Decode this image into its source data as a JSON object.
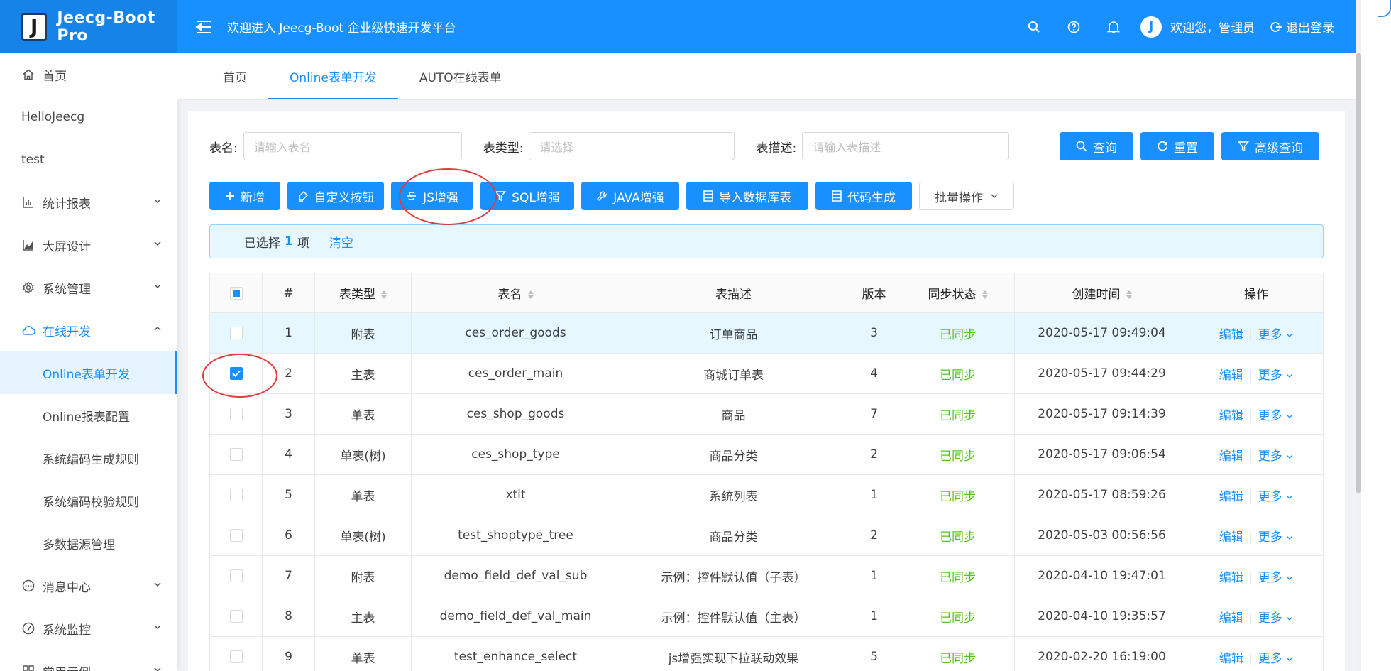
{
  "header": {
    "logo_letter": "J",
    "brand": "Jeecg-Boot Pro",
    "welcome": "欢迎进入 Jeecg-Boot 企业级快速开发平台",
    "avatar_letter": "J",
    "user_greeting": "欢迎您，管理员",
    "logout": "退出登录"
  },
  "sidebar": {
    "items": [
      {
        "label": "首页",
        "icon": "home-icon"
      },
      {
        "label": "HelloJeecg"
      },
      {
        "label": "test"
      },
      {
        "label": "统计报表",
        "icon": "bar-chart-icon"
      },
      {
        "label": "大屏设计",
        "icon": "area-chart-icon"
      },
      {
        "label": "系统管理",
        "icon": "gear-icon"
      },
      {
        "label": "在线开发",
        "icon": "cloud-icon"
      },
      {
        "label": "Online表单开发"
      },
      {
        "label": "Online报表配置"
      },
      {
        "label": "系统编码生成规则"
      },
      {
        "label": "系统编码校验规则"
      },
      {
        "label": "多数据源管理"
      },
      {
        "label": "消息中心",
        "icon": "message-icon"
      },
      {
        "label": "系统监控",
        "icon": "dashboard-icon"
      },
      {
        "label": "常用示例"
      }
    ]
  },
  "tabs": [
    "首页",
    "Online表单开发",
    "AUTO在线表单"
  ],
  "filters": {
    "table_name_label": "表名:",
    "table_name_placeholder": "请输入表名",
    "table_type_label": "表类型:",
    "table_type_placeholder": "请选择",
    "table_desc_label": "表描述:",
    "table_desc_placeholder": "请输入表描述"
  },
  "query_buttons": {
    "search": "查询",
    "reset": "重置",
    "advanced": "高级查询"
  },
  "toolbar": {
    "add": "新增",
    "custom_button": "自定义按钮",
    "js_enhance": "JS增强",
    "sql_enhance": "SQL增强",
    "java_enhance": "JAVA增强",
    "import_db": "导入数据库表",
    "code_gen": "代码生成",
    "batch": "批量操作"
  },
  "alert": {
    "prefix": "已选择",
    "count": "1",
    "suffix": "项",
    "clear": "清空"
  },
  "table": {
    "headers": [
      "#",
      "表类型",
      "表名",
      "表描述",
      "版本",
      "同步状态",
      "创建时间",
      "操作"
    ],
    "edit": "编辑",
    "more": "更多",
    "rows": [
      {
        "no": "1",
        "type": "附表",
        "name": "ces_order_goods",
        "desc": "订单商品",
        "ver": "3",
        "sync": "已同步",
        "time": "2020-05-17 09:49:04"
      },
      {
        "no": "2",
        "type": "主表",
        "name": "ces_order_main",
        "desc": "商城订单表",
        "ver": "4",
        "sync": "已同步",
        "time": "2020-05-17 09:44:29"
      },
      {
        "no": "3",
        "type": "单表",
        "name": "ces_shop_goods",
        "desc": "商品",
        "ver": "7",
        "sync": "已同步",
        "time": "2020-05-17 09:14:39"
      },
      {
        "no": "4",
        "type": "单表(树)",
        "name": "ces_shop_type",
        "desc": "商品分类",
        "ver": "2",
        "sync": "已同步",
        "time": "2020-05-17 09:06:54"
      },
      {
        "no": "5",
        "type": "单表",
        "name": "xtlt",
        "desc": "系统列表",
        "ver": "1",
        "sync": "已同步",
        "time": "2020-05-17 08:59:26"
      },
      {
        "no": "6",
        "type": "单表(树)",
        "name": "test_shoptype_tree",
        "desc": "商品分类",
        "ver": "2",
        "sync": "已同步",
        "time": "2020-05-03 00:56:56"
      },
      {
        "no": "7",
        "type": "附表",
        "name": "demo_field_def_val_sub",
        "desc": "示例：控件默认值（子表）",
        "ver": "1",
        "sync": "已同步",
        "time": "2020-04-10 19:47:01"
      },
      {
        "no": "8",
        "type": "主表",
        "name": "demo_field_def_val_main",
        "desc": "示例：控件默认值（主表）",
        "ver": "1",
        "sync": "已同步",
        "time": "2020-04-10 19:35:57"
      },
      {
        "no": "9",
        "type": "单表",
        "name": "test_enhance_select",
        "desc": "js增强实现下拉联动效果",
        "ver": "5",
        "sync": "已同步",
        "time": "2020-02-20 16:19:00"
      }
    ]
  },
  "colors": {
    "primary": "#1890ff",
    "success": "#52c41a",
    "annotation": "#e03a3a"
  }
}
